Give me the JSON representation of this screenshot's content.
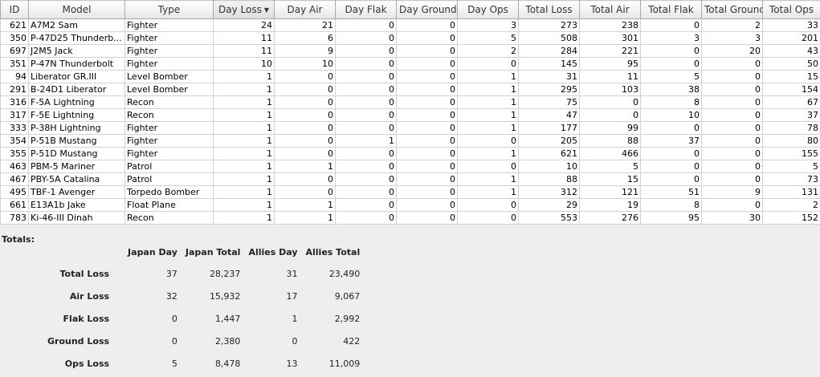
{
  "table": {
    "columns": [
      {
        "label": "ID",
        "key": "id"
      },
      {
        "label": "Model",
        "key": "model"
      },
      {
        "label": "Type",
        "key": "type"
      },
      {
        "label": "Day Loss",
        "key": "day_loss",
        "sorted": "desc"
      },
      {
        "label": "Day Air",
        "key": "day_air"
      },
      {
        "label": "Day Flak",
        "key": "day_flak"
      },
      {
        "label": "Day Ground",
        "key": "day_ground"
      },
      {
        "label": "Day Ops",
        "key": "day_ops"
      },
      {
        "label": "Total Loss",
        "key": "total_loss"
      },
      {
        "label": "Total Air",
        "key": "total_air"
      },
      {
        "label": "Total Flak",
        "key": "total_flak"
      },
      {
        "label": "Total Ground",
        "key": "total_ground"
      },
      {
        "label": "Total Ops",
        "key": "total_ops"
      }
    ],
    "rows": [
      [
        "621",
        "A7M2 Sam",
        "Fighter",
        "24",
        "21",
        "0",
        "0",
        "3",
        "273",
        "238",
        "0",
        "2",
        "33"
      ],
      [
        "350",
        "P-47D25 Thunderb...",
        "Fighter",
        "11",
        "6",
        "0",
        "0",
        "5",
        "508",
        "301",
        "3",
        "3",
        "201"
      ],
      [
        "697",
        "J2M5 Jack",
        "Fighter",
        "11",
        "9",
        "0",
        "0",
        "2",
        "284",
        "221",
        "0",
        "20",
        "43"
      ],
      [
        "351",
        "P-47N Thunderbolt",
        "Fighter",
        "10",
        "10",
        "0",
        "0",
        "0",
        "145",
        "95",
        "0",
        "0",
        "50"
      ],
      [
        "94",
        "Liberator GR.III",
        "Level Bomber",
        "1",
        "0",
        "0",
        "0",
        "1",
        "31",
        "11",
        "5",
        "0",
        "15"
      ],
      [
        "291",
        "B-24D1 Liberator",
        "Level Bomber",
        "1",
        "0",
        "0",
        "0",
        "1",
        "295",
        "103",
        "38",
        "0",
        "154"
      ],
      [
        "316",
        "F-5A Lightning",
        "Recon",
        "1",
        "0",
        "0",
        "0",
        "1",
        "75",
        "0",
        "8",
        "0",
        "67"
      ],
      [
        "317",
        "F-5E Lightning",
        "Recon",
        "1",
        "0",
        "0",
        "0",
        "1",
        "47",
        "0",
        "10",
        "0",
        "37"
      ],
      [
        "333",
        "P-38H Lightning",
        "Fighter",
        "1",
        "0",
        "0",
        "0",
        "1",
        "177",
        "99",
        "0",
        "0",
        "78"
      ],
      [
        "354",
        "P-51B Mustang",
        "Fighter",
        "1",
        "0",
        "1",
        "0",
        "0",
        "205",
        "88",
        "37",
        "0",
        "80"
      ],
      [
        "355",
        "P-51D Mustang",
        "Fighter",
        "1",
        "0",
        "0",
        "0",
        "1",
        "621",
        "466",
        "0",
        "0",
        "155"
      ],
      [
        "463",
        "PBM-5 Mariner",
        "Patrol",
        "1",
        "1",
        "0",
        "0",
        "0",
        "10",
        "5",
        "0",
        "0",
        "5"
      ],
      [
        "467",
        "PBY-5A Catalina",
        "Patrol",
        "1",
        "0",
        "0",
        "0",
        "1",
        "88",
        "15",
        "0",
        "0",
        "73"
      ],
      [
        "495",
        "TBF-1 Avenger",
        "Torpedo Bomber",
        "1",
        "0",
        "0",
        "0",
        "1",
        "312",
        "121",
        "51",
        "9",
        "131"
      ],
      [
        "661",
        "E13A1b Jake",
        "Float Plane",
        "1",
        "1",
        "0",
        "0",
        "0",
        "29",
        "19",
        "8",
        "0",
        "2"
      ],
      [
        "783",
        "Ki-46-III Dinah",
        "Recon",
        "1",
        "1",
        "0",
        "0",
        "0",
        "553",
        "276",
        "95",
        "30",
        "152"
      ]
    ]
  },
  "totals": {
    "label": "Totals:",
    "headers": [
      "Japan Day",
      "Japan Total",
      "Allies Day",
      "Allies Total"
    ],
    "rows": [
      {
        "label": "Total Loss",
        "values": [
          "37",
          "28,237",
          "31",
          "23,490"
        ]
      },
      {
        "label": "Air Loss",
        "values": [
          "32",
          "15,932",
          "17",
          "9,067"
        ]
      },
      {
        "label": "Flak Loss",
        "values": [
          "0",
          "1,447",
          "1",
          "2,992"
        ]
      },
      {
        "label": "Ground Loss",
        "values": [
          "0",
          "2,380",
          "0",
          "422"
        ]
      },
      {
        "label": "Ops Loss",
        "values": [
          "5",
          "8,478",
          "13",
          "11,009"
        ]
      }
    ]
  }
}
